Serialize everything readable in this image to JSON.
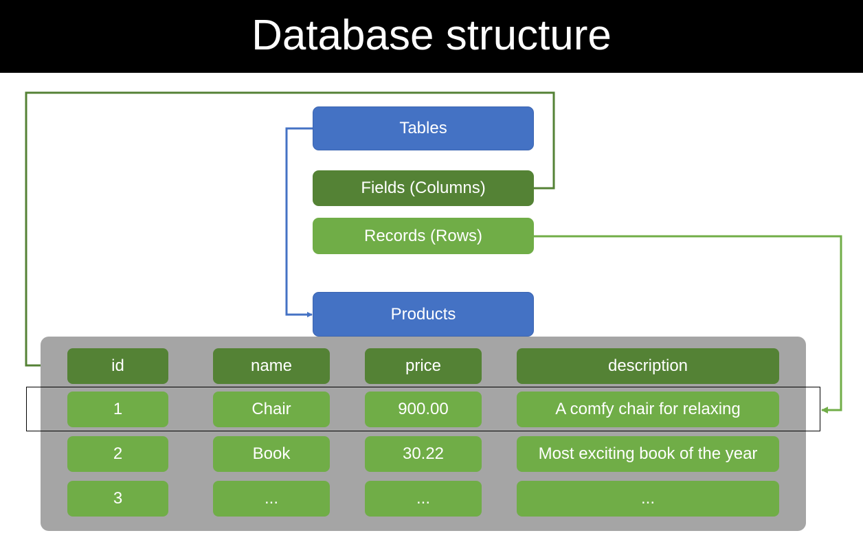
{
  "title": "Database structure",
  "concepts": {
    "tables": "Tables",
    "fields": "Fields (Columns)",
    "records": "Records (Rows)"
  },
  "table_name": "Products",
  "table": {
    "columns": [
      "id",
      "name",
      "price",
      "description"
    ],
    "rows": [
      [
        "1",
        "Chair",
        "900.00",
        "A comfy chair for relaxing"
      ],
      [
        "2",
        "Book",
        "30.22",
        "Most exciting book of the year"
      ],
      [
        "3",
        "...",
        "...",
        "..."
      ]
    ]
  },
  "colors": {
    "tables": "#4472c4",
    "fields": "#548235",
    "records": "#70ad47",
    "panel": "#a5a5a5",
    "title_bg": "#000000"
  }
}
